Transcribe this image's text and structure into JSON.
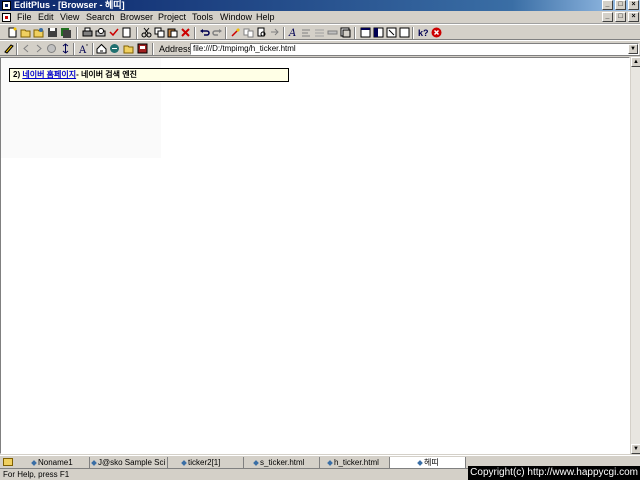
{
  "window": {
    "title": "EditPlus - [Browser - 헤띠]",
    "controls": [
      "_",
      "□",
      "×"
    ]
  },
  "menubar": {
    "items": [
      "File",
      "Edit",
      "View",
      "Search",
      "Browser",
      "Project",
      "Tools",
      "Window",
      "Help"
    ],
    "mdi_controls": [
      "_",
      "□",
      "×"
    ]
  },
  "toolbar1": {
    "icons": [
      "new-file-icon",
      "open-icon",
      "open-remote-icon",
      "save-icon",
      "save-all-icon",
      "print-icon",
      "print-preview-icon",
      "spell-check-icon",
      "cut-icon",
      "copy-icon",
      "paste-icon",
      "delete-icon",
      "undo-icon",
      "redo-icon",
      "find-icon",
      "replace-icon",
      "find-in-files-icon",
      "goto-icon",
      "font-icon",
      "word-wrap-icon",
      "line-number-icon",
      "ruler-icon",
      "run-icon",
      "window-tile-icon",
      "window-cascade-icon",
      "full-screen-icon",
      "toggle-icon",
      "help-icon",
      "stop-icon"
    ]
  },
  "toolbar2": {
    "icons": [
      "pen-icon",
      "back-icon",
      "forward-icon",
      "stop-browser-icon",
      "refresh-icon",
      "font-size-icon",
      "home-icon",
      "favorites-icon",
      "folder-icon",
      "book-icon"
    ],
    "address_label": "Address",
    "address_value": "file:///D:/tmpimg/h_ticker.html"
  },
  "content": {
    "ticker_prefix": "2) ",
    "ticker_link": "네이버 홈페이지",
    "ticker_suffix": "- 네이버 검색 엔진"
  },
  "tabs": [
    {
      "label": "Noname1",
      "active": false
    },
    {
      "label": "J@sko Sample Sci",
      "active": false
    },
    {
      "label": "ticker2[1]",
      "active": false
    },
    {
      "label": "s_ticker.html",
      "active": false
    },
    {
      "label": "h_ticker.html",
      "active": false
    },
    {
      "label": "헤띠",
      "active": true
    }
  ],
  "statusbar": {
    "text": "For Help, press F1",
    "copyright": "Copyright(c) http://www.happycgi.com"
  }
}
